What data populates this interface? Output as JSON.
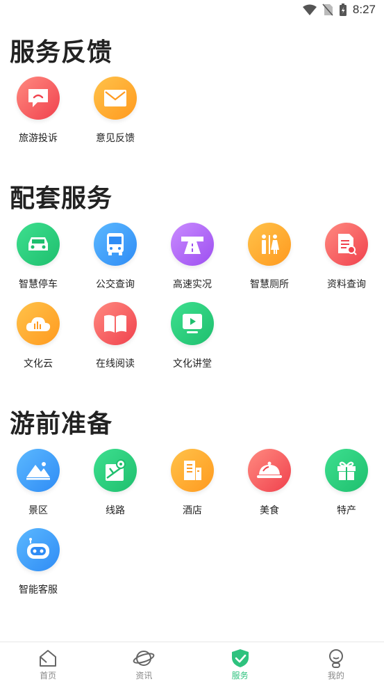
{
  "status_bar": {
    "time": "8:27"
  },
  "sections": [
    {
      "title": "服务反馈",
      "items": [
        {
          "label": "旅游投诉",
          "icon": "chat-complaint-icon",
          "color_from": "#ff8a80",
          "color_to": "#f0414d"
        },
        {
          "label": "意见反馈",
          "icon": "envelope-icon",
          "color_from": "#ffc24a",
          "color_to": "#ff9a1f"
        }
      ]
    },
    {
      "title": "配套服务",
      "items": [
        {
          "label": "智慧停车",
          "icon": "car-icon",
          "color_from": "#3ddf8f",
          "color_to": "#1fbf6e"
        },
        {
          "label": "公交查询",
          "icon": "bus-icon",
          "color_from": "#5bb8ff",
          "color_to": "#2f8cf5"
        },
        {
          "label": "高速实况",
          "icon": "highway-icon",
          "color_from": "#c98bff",
          "color_to": "#9d4ff0"
        },
        {
          "label": "智慧厕所",
          "icon": "restroom-icon",
          "color_from": "#ffc24a",
          "color_to": "#ff9a1f"
        },
        {
          "label": "资料查询",
          "icon": "document-search-icon",
          "color_from": "#ff8a80",
          "color_to": "#f0414d"
        },
        {
          "label": "文化云",
          "icon": "culture-cloud-icon",
          "color_from": "#ffc24a",
          "color_to": "#ff9a1f"
        },
        {
          "label": "在线阅读",
          "icon": "book-icon",
          "color_from": "#ff8a80",
          "color_to": "#f0414d"
        },
        {
          "label": "文化讲堂",
          "icon": "video-lecture-icon",
          "color_from": "#3ddf8f",
          "color_to": "#1fbf6e"
        }
      ]
    },
    {
      "title": "游前准备",
      "items": [
        {
          "label": "景区",
          "icon": "scenic-mountain-icon",
          "color_from": "#5bb8ff",
          "color_to": "#2f8cf5"
        },
        {
          "label": "线路",
          "icon": "route-map-icon",
          "color_from": "#3ddf8f",
          "color_to": "#1fbf6e"
        },
        {
          "label": "酒店",
          "icon": "hotel-building-icon",
          "color_from": "#ffc24a",
          "color_to": "#ff9a1f"
        },
        {
          "label": "美食",
          "icon": "food-cloche-icon",
          "color_from": "#ff8a80",
          "color_to": "#f0414d"
        },
        {
          "label": "特产",
          "icon": "gift-icon",
          "color_from": "#3ddf8f",
          "color_to": "#1fbf6e"
        },
        {
          "label": "智能客服",
          "icon": "robot-icon",
          "color_from": "#5bb8ff",
          "color_to": "#2f8cf5"
        }
      ]
    }
  ],
  "bottom_nav": [
    {
      "label": "首页",
      "icon": "home-icon",
      "active": false
    },
    {
      "label": "资讯",
      "icon": "planet-icon",
      "active": false
    },
    {
      "label": "服务",
      "icon": "shield-check-icon",
      "active": true
    },
    {
      "label": "我的",
      "icon": "profile-icon",
      "active": false
    }
  ],
  "colors": {
    "accent": "#2ec27e",
    "text": "#222222",
    "nav_inactive": "#888888"
  }
}
